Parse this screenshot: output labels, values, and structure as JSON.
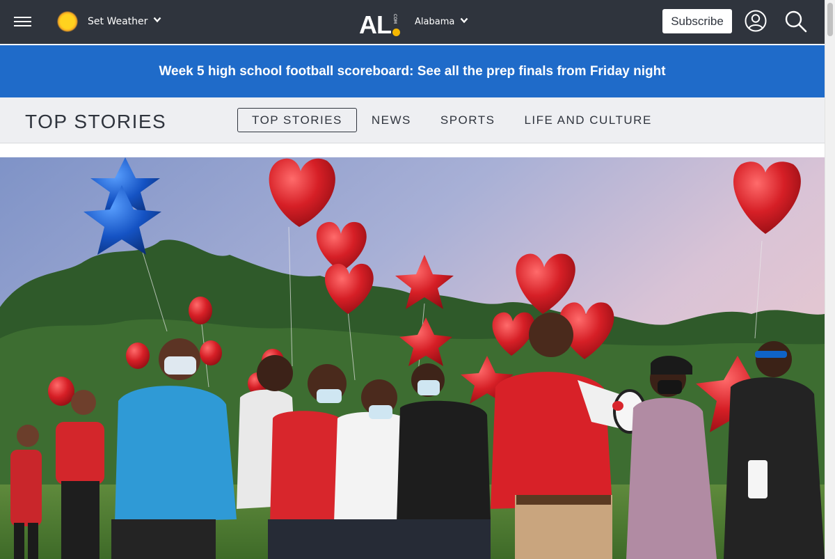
{
  "header": {
    "weather_label": "Set Weather",
    "logo_text": "AL",
    "logo_suffix": "COM",
    "region_label": "Alabama",
    "subscribe_label": "Subscribe",
    "background_color": "#2f343d",
    "logo_accent_color": "#f5b700"
  },
  "banner": {
    "text": "Week 5 high school football scoreboard: See all the prep finals from Friday night",
    "background_color": "#1f6bc9"
  },
  "section": {
    "title": "TOP STORIES",
    "tabs": [
      {
        "label": "TOP STORIES",
        "active": true
      },
      {
        "label": "NEWS",
        "active": false
      },
      {
        "label": "SPORTS",
        "active": false
      },
      {
        "label": "LIFE AND CULTURE",
        "active": false
      }
    ]
  },
  "icons": {
    "menu": "hamburger-menu-icon",
    "weather": "sun-icon",
    "dropdown": "chevron-down-icon",
    "account": "user-icon",
    "search": "search-icon"
  }
}
